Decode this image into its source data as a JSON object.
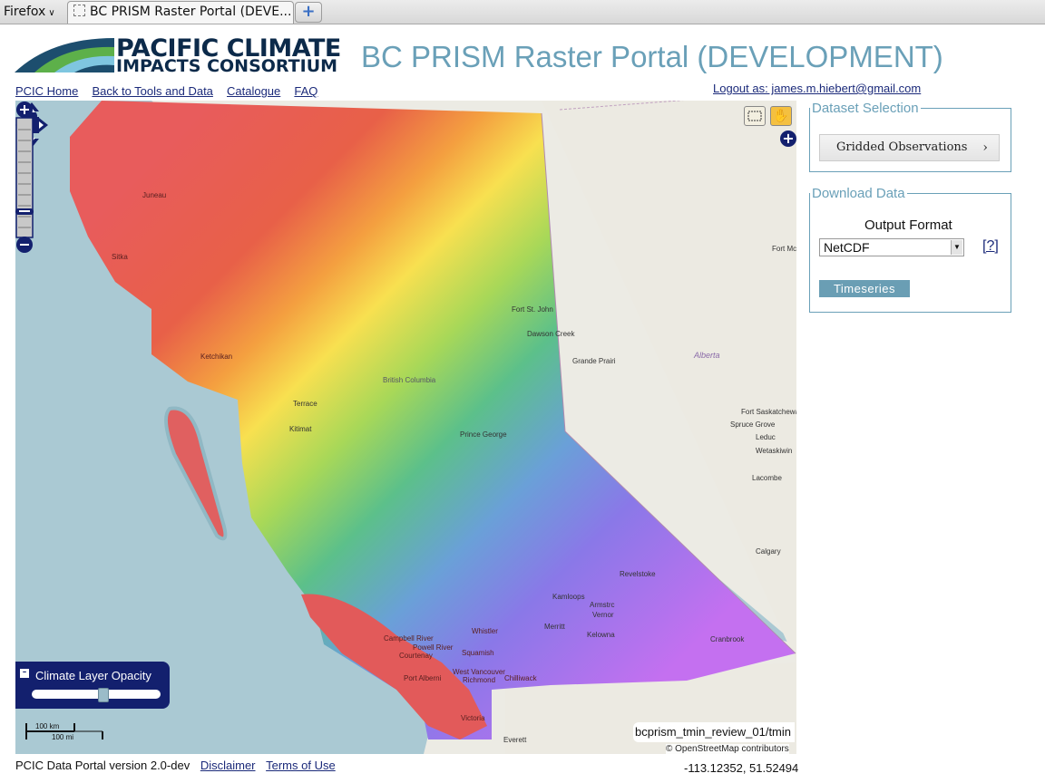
{
  "browser": {
    "app_menu": "Firefox",
    "tab_title": "BC PRISM Raster Portal (DEVE...",
    "new_tab_label": "+"
  },
  "header": {
    "logo_line1": "PACIFIC CLIMATE",
    "logo_line2": "IMPACTS CONSORTIUM",
    "title": "BC PRISM Raster Portal (DEVELOPMENT)"
  },
  "nav": {
    "links": [
      "PCIC Home",
      "Back to Tools and Data",
      "Catalogue",
      "FAQ"
    ],
    "logout": "Logout as: james.m.hiebert@gmail.com"
  },
  "map": {
    "layer_name": "bcprism_tmin_review_01/tmin",
    "attribution": "© OpenStreetMap contributors",
    "opacity_label": "Climate Layer Opacity",
    "opacity_value": 0.56,
    "scale_km": "100 km",
    "scale_mi": "100 mi",
    "place_labels": [
      "Juneau",
      "Sitka",
      "Ketchikan",
      "Terrace",
      "Kitimat",
      "British Columbia",
      "Prince George",
      "Fort St. John",
      "Dawson Creek",
      "Grande Prairi",
      "Alberta",
      "Fort Mc",
      "Fort Saskatchewa",
      "Spruce Grove",
      "Leduc",
      "Wetaskiwin",
      "Lacombe",
      "Calgary",
      "Revelstoke",
      "Kamloops",
      "Armstrc",
      "Vernor",
      "Merritt",
      "Kelowna",
      "Cranbrook",
      "Campbell River",
      "Powell River",
      "Courtenay",
      "Whistler",
      "Squamish",
      "West Vancouver",
      "Richmond",
      "Chilliwack",
      "Port Alberni",
      "Victoria",
      "Everett"
    ]
  },
  "dataset_selection": {
    "legend": "Dataset Selection",
    "button": "Gridded Observations",
    "chevron": "›"
  },
  "download": {
    "legend": "Download Data",
    "output_format_label": "Output Format",
    "format_value": "NetCDF",
    "help": "[?]",
    "timeseries_button": "Timeseries"
  },
  "footer": {
    "version": "PCIC Data Portal version 2.0-dev",
    "disclaimer": "Disclaimer",
    "terms": "Terms of Use",
    "coords": "-113.12352, 51.52494"
  }
}
